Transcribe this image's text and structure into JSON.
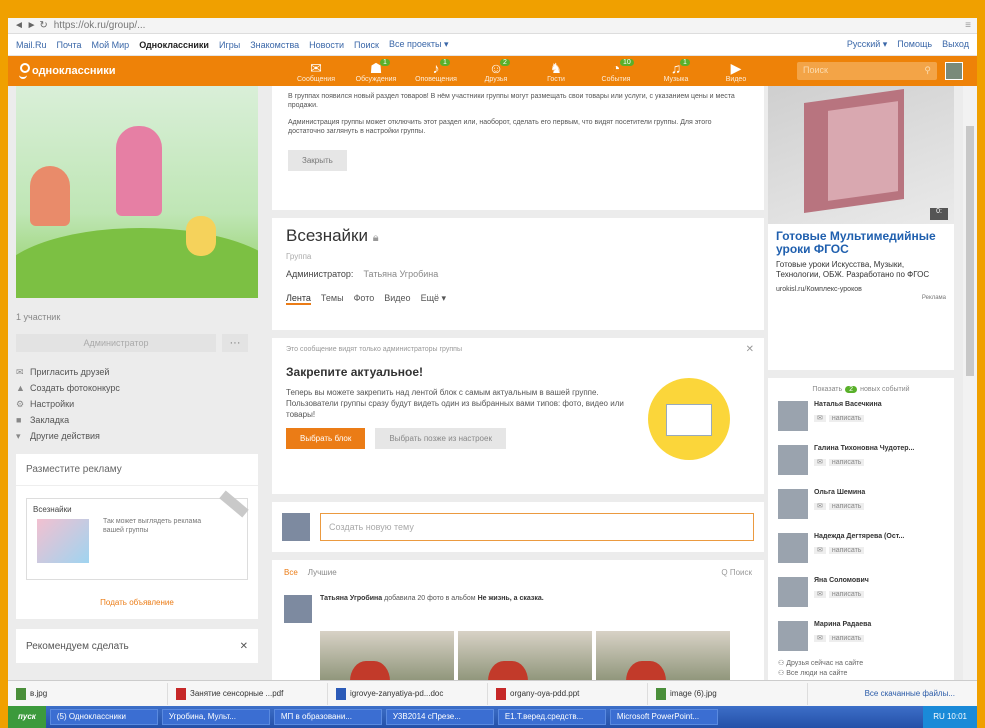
{
  "browser": {
    "url": "https://ok.ru/group/...",
    "controls": "◄ ► ↻"
  },
  "toplinks": {
    "items": [
      "Mail.Ru",
      "Почта",
      "Мой Мир",
      "Одноклассники",
      "Игры",
      "Знакомства",
      "Новости",
      "Поиск",
      "Все проекты ▾"
    ],
    "right": [
      "Русский ▾",
      "Помощь",
      "Выход"
    ]
  },
  "okheader": {
    "logo": "одноклассники",
    "nav": [
      {
        "icon": "✉",
        "label": "Сообщения",
        "badge": ""
      },
      {
        "icon": "☗",
        "label": "Обсуждения",
        "badge": "1"
      },
      {
        "icon": "♪",
        "label": "Оповещения",
        "badge": "1"
      },
      {
        "icon": "☺",
        "label": "Друзья",
        "badge": "2"
      },
      {
        "icon": "♞",
        "label": "Гости",
        "badge": ""
      },
      {
        "icon": "◔",
        "label": "События",
        "badge": "10"
      },
      {
        "icon": "♫",
        "label": "Музыка",
        "badge": "1"
      },
      {
        "icon": "▶",
        "label": "Видео",
        "badge": ""
      }
    ],
    "search_placeholder": "Поиск"
  },
  "left": {
    "participants": "1 участник",
    "admin_button": "Администратор",
    "more_button": "···",
    "actions": [
      {
        "icon": "✉",
        "label": "Пригласить друзей"
      },
      {
        "icon": "▲",
        "label": "Создать фотоконкурс"
      },
      {
        "icon": "⚙",
        "label": "Настройки"
      },
      {
        "icon": "■",
        "label": "Закладка"
      },
      {
        "icon": "▾",
        "label": "Другие действия"
      }
    ],
    "ad_panel_title": "Разместите рекламу",
    "ad_card_name": "Всезнайки",
    "ad_card_text": "Так может выглядеть реклама вашей группы",
    "ad_link": "Подать объявление",
    "recommend": "Рекомендуем сделать",
    "recommend_close": "✕"
  },
  "notice": {
    "p1": "В группах появился новый раздел товаров! В нём участники группы могут размещать свои товары или услуги, с указанием цены и места продажи.",
    "p2": "Администрация группы может отключить этот раздел или, наоборот, сделать его первым, что видят посетители группы. Для этого достаточно заглянуть в настройки группы.",
    "close": "Закрыть"
  },
  "group": {
    "name": "Всезнайки",
    "type": "Группа",
    "admin_label": "Администратор:",
    "admin_name": "Татьяна Угробина",
    "tabs": [
      "Лента",
      "Темы",
      "Фото",
      "Видео",
      "Ещё ▾"
    ]
  },
  "pin": {
    "note": "Это сообщение видят только администраторы группы",
    "title": "Закрепите актуальное!",
    "text": "Теперь вы можете закрепить над лентой блок с самым актуальным в вашей группе. Пользователи группы сразу будут видеть один из выбранных вами типов: фото, видео или товары!",
    "btn_primary": "Выбрать блок",
    "btn_secondary": "Выбрать позже из настроек",
    "close": "✕"
  },
  "newtopic": {
    "placeholder": "Создать новую тему"
  },
  "feed": {
    "tabs": [
      "Все",
      "Лучшие"
    ],
    "search": "Q Поиск",
    "author": "Татьяна Угробина",
    "action": "добавила 20 фото в альбом",
    "album": "Не жизнь, а сказка."
  },
  "promo": {
    "title": "Готовые Мультимедийные уроки ФГОС",
    "text": "Готовые уроки Искусства, Музыки, Технологии, ОБЖ. Разработано по ФГОС",
    "source": "urokisl.ru/Комплекс-уроков",
    "adv": "Реклама",
    "play": "0:"
  },
  "events": {
    "prefix": "Показать",
    "count": "2",
    "suffix": "новых событий",
    "write": "написать",
    "friends": [
      "Наталья Васечкина",
      "Галина Тихоновна Чудотер...",
      "Ольга Шемина",
      "Надежда Дегтярева (Ост...",
      "Яна Соломович",
      "Марина Радаева"
    ],
    "online": "Друзья сейчас на сайте",
    "all_people": "Все люди на сайте"
  },
  "downloads": {
    "items": [
      {
        "name": "в.jpg",
        "kind": "img"
      },
      {
        "name": "Занятие сенсорные ...pdf",
        "kind": "pdf"
      },
      {
        "name": "igrovye-zanyatiya-pd...doc",
        "kind": "doc"
      },
      {
        "name": "organy-oya-pdd.ppt",
        "kind": "pdf"
      },
      {
        "name": "image (6).jpg",
        "kind": "img"
      }
    ],
    "all": "Все скачанные файлы..."
  },
  "taskbar": {
    "start": "пуск",
    "tasks": [
      "(5) Одноклассники",
      "Угробина, Мульт...",
      "МП в образовани...",
      "У3В2014 сПрезе...",
      "Е1.Т.веред.средств...",
      "Microsoft PowerPoint..."
    ],
    "tray": "RU  10:01"
  }
}
